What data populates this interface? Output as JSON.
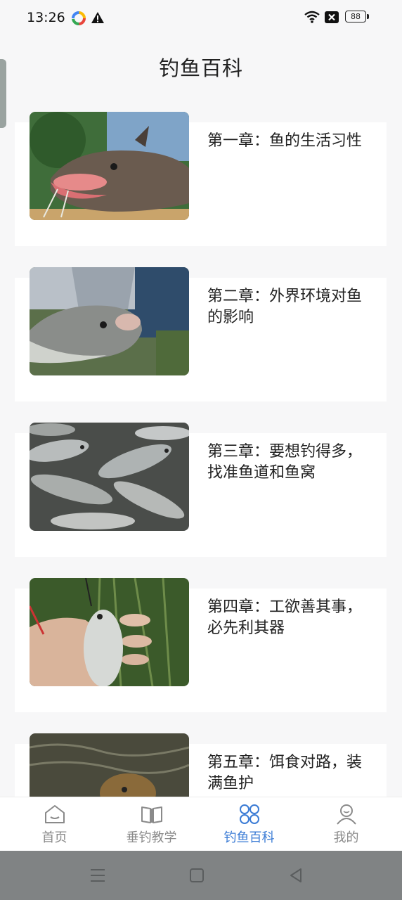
{
  "status_bar": {
    "time": "13:26",
    "battery": "88"
  },
  "page": {
    "title": "钓鱼百科"
  },
  "chapters": [
    {
      "title": "第一章：鱼的生活习性",
      "image": "catfish-photo"
    },
    {
      "title": "第二章：外界环境对鱼的影响",
      "image": "bighead-carp-photo"
    },
    {
      "title": "第三章：要想钓得多，找准鱼道和鱼窝",
      "image": "fish-pile-photo"
    },
    {
      "title": "第四章：工欲善其事，必先利其器",
      "image": "crucian-in-hand-photo"
    },
    {
      "title": "第五章：饵食对路，装满鱼护",
      "image": "fish-in-water-photo"
    }
  ],
  "tabs": [
    {
      "label": "首页",
      "icon": "home-icon",
      "active": false
    },
    {
      "label": "垂钓教学",
      "icon": "book-icon",
      "active": false
    },
    {
      "label": "钓鱼百科",
      "icon": "grid-icon",
      "active": true
    },
    {
      "label": "我的",
      "icon": "user-icon",
      "active": false
    }
  ],
  "colors": {
    "accent": "#3a7bd5",
    "inactive": "#8a8a8a",
    "background": "#f7f7f8"
  }
}
